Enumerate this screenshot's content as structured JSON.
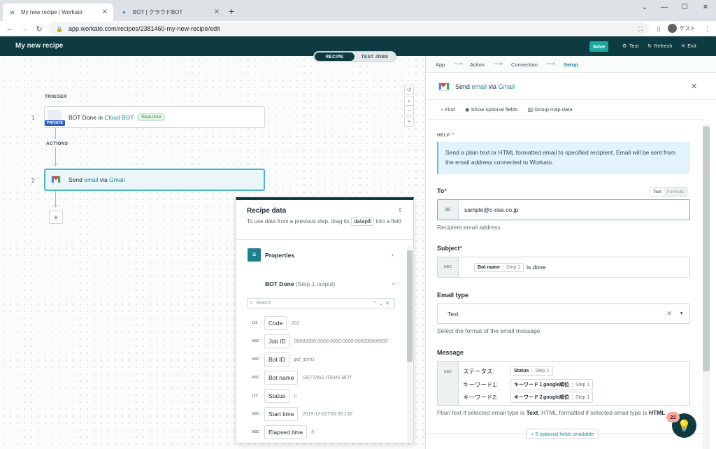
{
  "browser": {
    "tabs": [
      {
        "title": "My new recipe | Workato",
        "active": true
      },
      {
        "title": "BOT | クラウドBOT",
        "active": false
      }
    ],
    "url": "app.workato.com/recipes/2381460-my-new-recipe/edit",
    "profile_label": "ゲスト"
  },
  "header": {
    "title": "My new recipe",
    "save_label": "Save",
    "test_label": "Test",
    "refresh_label": "Refresh",
    "exit_label": "Exit"
  },
  "toggle": {
    "recipe": "RECIPE",
    "test_jobs": "TEST JOBS"
  },
  "canvas": {
    "trigger_label": "TRIGGER",
    "actions_label": "ACTIONS",
    "steps": [
      {
        "num": "1",
        "pre": "BOT Done in ",
        "app": "Cloud BOT",
        "badge": "Real-time",
        "private": "PRIVATE"
      },
      {
        "num": "2",
        "pre": "Send ",
        "action": "email",
        "mid": " via ",
        "app": "Gmail"
      }
    ]
  },
  "recipe_data": {
    "title": "Recipe data",
    "desc_pre": "To use data from a previous step, drag its",
    "datapill": "datapill",
    "desc_post": "into a field",
    "properties": "Properties",
    "output_title": "BOT Done",
    "output_sub": "(Step 1 output)",
    "search_placeholder": "Search",
    "pills": [
      {
        "type": "123",
        "name": "Code",
        "value": "201"
      },
      {
        "type": "ABC",
        "name": "Job ID",
        "value": "00000000-0000-0000-0000-000000000000"
      },
      {
        "type": "ABC",
        "name": "Bot ID",
        "value": "get_items"
      },
      {
        "type": "ABC",
        "name": "Bot name",
        "value": "GETTING ITEMS BOT"
      },
      {
        "type": "123",
        "name": "Status",
        "value": "0"
      },
      {
        "type": "ABC",
        "name": "Start time",
        "value": "2019-12-02T05:30:13Z"
      },
      {
        "type": "ABC",
        "name": "Elapsed time",
        "value": "6"
      }
    ]
  },
  "right": {
    "breadcrumbs": [
      "App",
      "Action",
      "Connection",
      "Setup"
    ],
    "title_pre": "Send ",
    "title_action": "email",
    "title_mid": " via ",
    "title_app": "Gmail",
    "tools": {
      "find": "Find",
      "optional": "Show optional fields",
      "group": "Group map data"
    },
    "help_label": "HELP",
    "help_text": "Send a plain text or HTML formatted email to specified recipient. Email will be sent from the email address connected to Workato.",
    "to": {
      "label": "To",
      "mode_text": "Text",
      "mode_formula": "Formula",
      "value": "sample@c-rise.co.jp",
      "hint": "Recipient email address"
    },
    "subject": {
      "label": "Subject",
      "abc": "ABC",
      "pill_name": "Bot name",
      "pill_step": "Step 1",
      "suffix": "is done"
    },
    "email_type": {
      "label": "Email type",
      "value": "Text",
      "hint": "Select the format of the email message"
    },
    "message": {
      "label": "Message",
      "abc": "ABC",
      "lines": [
        {
          "text": "ステータス:",
          "pill": "Status",
          "step": "Step 1"
        },
        {
          "text": "キーワード1:",
          "pill": "キーワード１google順位",
          "step": "Step 1"
        },
        {
          "text": "キーワード2:",
          "pill": "キーワード２google順位",
          "step": "Step 1"
        }
      ],
      "hint_pre": "Plain text if selected email type is ",
      "hint_text": "Text",
      "hint_mid": ", HTML formatted if selected email type is ",
      "hint_html": "HTML"
    },
    "optional_button": "+ 5 optional fields available",
    "notif_count": "22"
  }
}
